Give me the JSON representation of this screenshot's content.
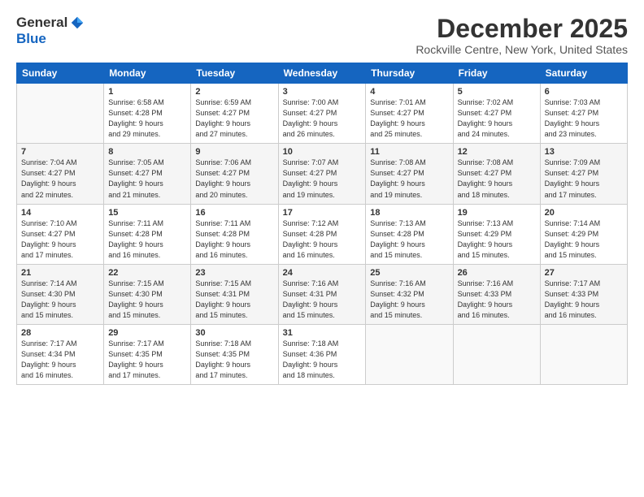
{
  "logo": {
    "general": "General",
    "blue": "Blue"
  },
  "header": {
    "month": "December 2025",
    "location": "Rockville Centre, New York, United States"
  },
  "weekdays": [
    "Sunday",
    "Monday",
    "Tuesday",
    "Wednesday",
    "Thursday",
    "Friday",
    "Saturday"
  ],
  "weeks": [
    [
      {
        "day": "",
        "info": ""
      },
      {
        "day": "1",
        "info": "Sunrise: 6:58 AM\nSunset: 4:28 PM\nDaylight: 9 hours\nand 29 minutes."
      },
      {
        "day": "2",
        "info": "Sunrise: 6:59 AM\nSunset: 4:27 PM\nDaylight: 9 hours\nand 27 minutes."
      },
      {
        "day": "3",
        "info": "Sunrise: 7:00 AM\nSunset: 4:27 PM\nDaylight: 9 hours\nand 26 minutes."
      },
      {
        "day": "4",
        "info": "Sunrise: 7:01 AM\nSunset: 4:27 PM\nDaylight: 9 hours\nand 25 minutes."
      },
      {
        "day": "5",
        "info": "Sunrise: 7:02 AM\nSunset: 4:27 PM\nDaylight: 9 hours\nand 24 minutes."
      },
      {
        "day": "6",
        "info": "Sunrise: 7:03 AM\nSunset: 4:27 PM\nDaylight: 9 hours\nand 23 minutes."
      }
    ],
    [
      {
        "day": "7",
        "info": "Sunrise: 7:04 AM\nSunset: 4:27 PM\nDaylight: 9 hours\nand 22 minutes."
      },
      {
        "day": "8",
        "info": "Sunrise: 7:05 AM\nSunset: 4:27 PM\nDaylight: 9 hours\nand 21 minutes."
      },
      {
        "day": "9",
        "info": "Sunrise: 7:06 AM\nSunset: 4:27 PM\nDaylight: 9 hours\nand 20 minutes."
      },
      {
        "day": "10",
        "info": "Sunrise: 7:07 AM\nSunset: 4:27 PM\nDaylight: 9 hours\nand 19 minutes."
      },
      {
        "day": "11",
        "info": "Sunrise: 7:08 AM\nSunset: 4:27 PM\nDaylight: 9 hours\nand 19 minutes."
      },
      {
        "day": "12",
        "info": "Sunrise: 7:08 AM\nSunset: 4:27 PM\nDaylight: 9 hours\nand 18 minutes."
      },
      {
        "day": "13",
        "info": "Sunrise: 7:09 AM\nSunset: 4:27 PM\nDaylight: 9 hours\nand 17 minutes."
      }
    ],
    [
      {
        "day": "14",
        "info": "Sunrise: 7:10 AM\nSunset: 4:27 PM\nDaylight: 9 hours\nand 17 minutes."
      },
      {
        "day": "15",
        "info": "Sunrise: 7:11 AM\nSunset: 4:28 PM\nDaylight: 9 hours\nand 16 minutes."
      },
      {
        "day": "16",
        "info": "Sunrise: 7:11 AM\nSunset: 4:28 PM\nDaylight: 9 hours\nand 16 minutes."
      },
      {
        "day": "17",
        "info": "Sunrise: 7:12 AM\nSunset: 4:28 PM\nDaylight: 9 hours\nand 16 minutes."
      },
      {
        "day": "18",
        "info": "Sunrise: 7:13 AM\nSunset: 4:28 PM\nDaylight: 9 hours\nand 15 minutes."
      },
      {
        "day": "19",
        "info": "Sunrise: 7:13 AM\nSunset: 4:29 PM\nDaylight: 9 hours\nand 15 minutes."
      },
      {
        "day": "20",
        "info": "Sunrise: 7:14 AM\nSunset: 4:29 PM\nDaylight: 9 hours\nand 15 minutes."
      }
    ],
    [
      {
        "day": "21",
        "info": "Sunrise: 7:14 AM\nSunset: 4:30 PM\nDaylight: 9 hours\nand 15 minutes."
      },
      {
        "day": "22",
        "info": "Sunrise: 7:15 AM\nSunset: 4:30 PM\nDaylight: 9 hours\nand 15 minutes."
      },
      {
        "day": "23",
        "info": "Sunrise: 7:15 AM\nSunset: 4:31 PM\nDaylight: 9 hours\nand 15 minutes."
      },
      {
        "day": "24",
        "info": "Sunrise: 7:16 AM\nSunset: 4:31 PM\nDaylight: 9 hours\nand 15 minutes."
      },
      {
        "day": "25",
        "info": "Sunrise: 7:16 AM\nSunset: 4:32 PM\nDaylight: 9 hours\nand 15 minutes."
      },
      {
        "day": "26",
        "info": "Sunrise: 7:16 AM\nSunset: 4:33 PM\nDaylight: 9 hours\nand 16 minutes."
      },
      {
        "day": "27",
        "info": "Sunrise: 7:17 AM\nSunset: 4:33 PM\nDaylight: 9 hours\nand 16 minutes."
      }
    ],
    [
      {
        "day": "28",
        "info": "Sunrise: 7:17 AM\nSunset: 4:34 PM\nDaylight: 9 hours\nand 16 minutes."
      },
      {
        "day": "29",
        "info": "Sunrise: 7:17 AM\nSunset: 4:35 PM\nDaylight: 9 hours\nand 17 minutes."
      },
      {
        "day": "30",
        "info": "Sunrise: 7:18 AM\nSunset: 4:35 PM\nDaylight: 9 hours\nand 17 minutes."
      },
      {
        "day": "31",
        "info": "Sunrise: 7:18 AM\nSunset: 4:36 PM\nDaylight: 9 hours\nand 18 minutes."
      },
      {
        "day": "",
        "info": ""
      },
      {
        "day": "",
        "info": ""
      },
      {
        "day": "",
        "info": ""
      }
    ]
  ]
}
